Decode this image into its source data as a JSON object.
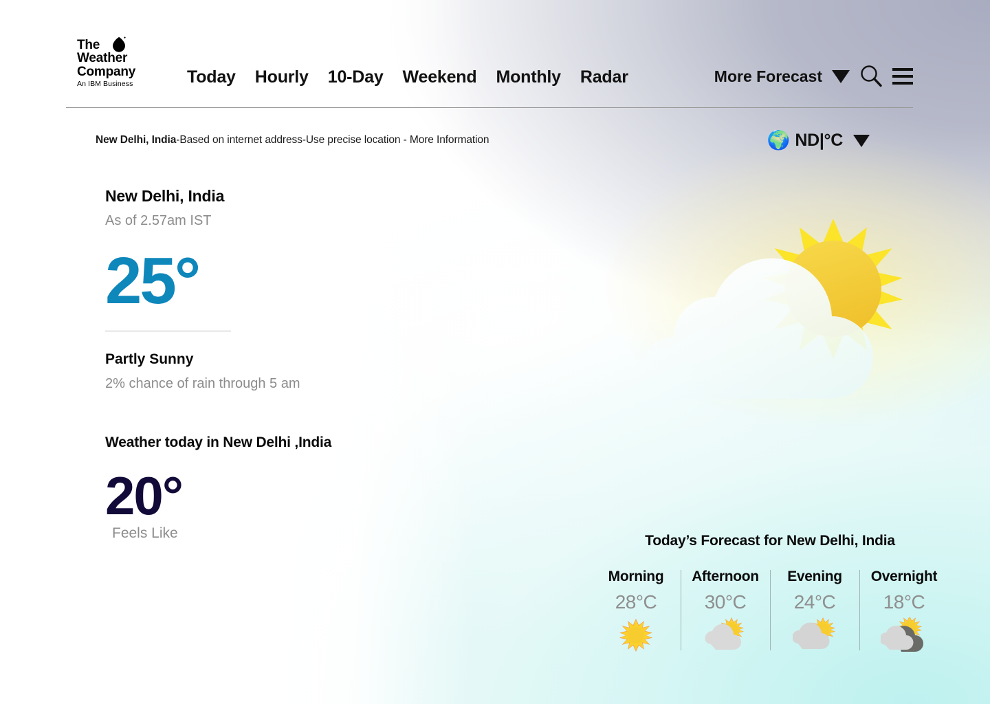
{
  "header": {
    "logo": {
      "line1": "The",
      "line2": "Weather",
      "line3": "Company",
      "tagline": "An IBM Business",
      "drop_icon": "water-drop-icon"
    },
    "nav": [
      {
        "label": "Today"
      },
      {
        "label": "Hourly"
      },
      {
        "label": "10-Day"
      },
      {
        "label": "Weekend"
      },
      {
        "label": "Monthly"
      },
      {
        "label": "Radar"
      }
    ],
    "more_forecast_label": "More Forecast",
    "more_forecast_caret": "chevron-down-icon",
    "search_icon": "search-icon",
    "menu_icon": "hamburger-menu-icon"
  },
  "location_bar": {
    "location": "New Delhi, India",
    "detail": "-Based on internet address-Use precise location - More Information"
  },
  "unit_selector": {
    "globe_icon": "globe-icon",
    "label": "ND|°C",
    "caret": "chevron-down-icon"
  },
  "current": {
    "city": "New Delhi, India",
    "as_of": "As of 2.57am IST",
    "temperature": "25°",
    "condition": "Partly Sunny",
    "rain_note": "2% chance of rain through 5 am",
    "hero_icon": "sun-behind-cloud-icon"
  },
  "today": {
    "title": "Weather today in New Delhi ,India",
    "feels_like_temp": "20°",
    "feels_like_label": "Feels Like"
  },
  "forecast": {
    "title": "Today’s Forecast for New Delhi, India",
    "periods": [
      {
        "label": "Morning",
        "temp": "28°C",
        "icon": "sun-icon"
      },
      {
        "label": "Afternoon",
        "temp": "30°C",
        "icon": "sun-behind-cloud-icon"
      },
      {
        "label": "Evening",
        "temp": "24°C",
        "icon": "sun-behind-large-cloud-icon"
      },
      {
        "label": "Overnight",
        "temp": "18°C",
        "icon": "sun-behind-dark-cloud-icon"
      }
    ]
  },
  "colors": {
    "current_temp_blue": "#0e87bb",
    "feels_like_navy": "#120a38",
    "muted_gray": "#8c8c8c",
    "sun_yellow": "#fbe42a",
    "sun_core": "#f5cd33",
    "bg_cyan": "#c5f0ee",
    "bg_lavender": "#b0b3c4"
  }
}
